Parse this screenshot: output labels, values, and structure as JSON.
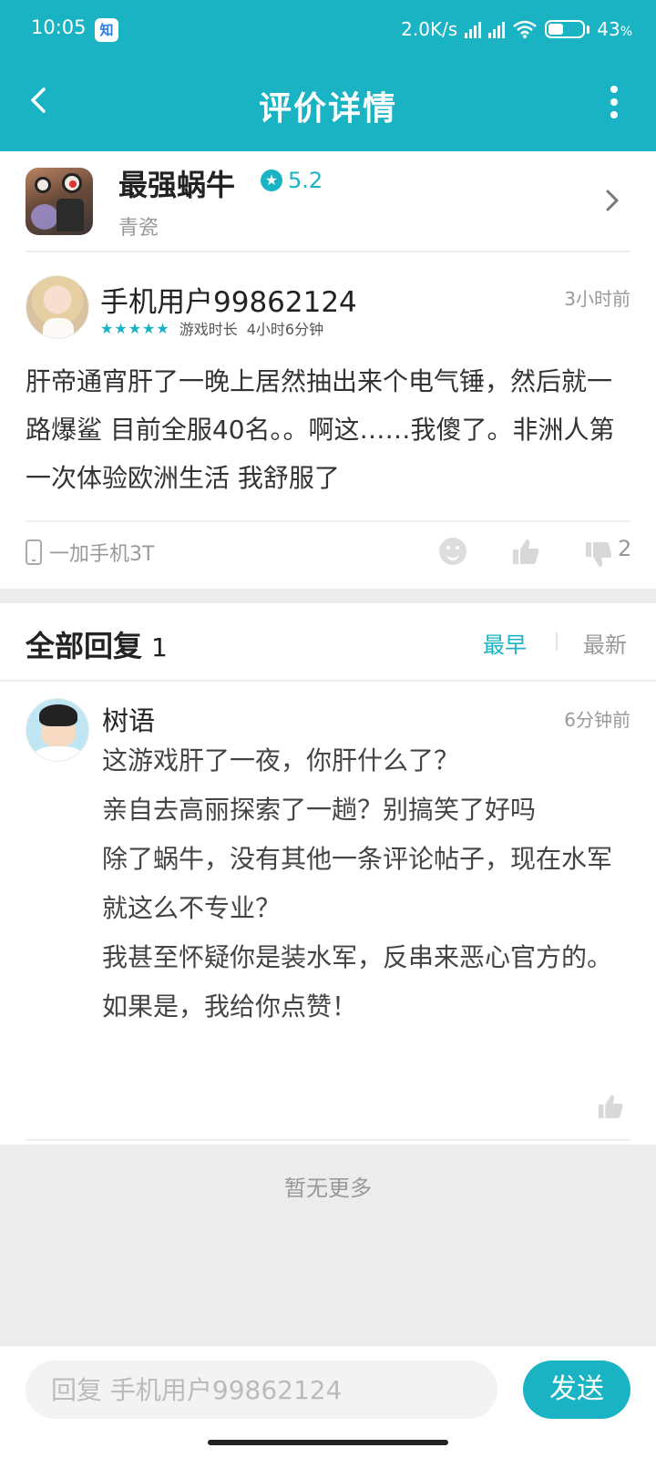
{
  "status_bar": {
    "time": "10:05",
    "app_badge": "知",
    "net_speed": "2.0K/s",
    "battery_pct": "43",
    "battery_pct_unit": "%",
    "battery_level": 0.43
  },
  "header": {
    "title": "评价详情"
  },
  "game": {
    "name": "最强蜗牛",
    "rating": "5.2",
    "developer": "青瓷"
  },
  "review": {
    "username": "手机用户99862124",
    "time_ago": "3小时前",
    "stars": "★★★★★",
    "star_count": 5,
    "playtime_label": "游戏时长",
    "playtime_value": "4小时6分钟",
    "body": "肝帝通宵肝了一晚上居然抽出来个电气锤，然后就一路爆鲨 目前全服40名。。啊这……我傻了。非洲人第一次体验欧洲生活 我舒服了",
    "device": "一加手机3T",
    "dislike_count": "2"
  },
  "replies": {
    "title": "全部回复",
    "count": "1",
    "sort_earliest": "最早",
    "sort_newest": "最新",
    "items": [
      {
        "username": "树语",
        "time_ago": "6分钟前",
        "lines": [
          "这游戏肝了一夜，你肝什么了？",
          "亲自去高丽探索了一趟？别搞笑了好吗",
          "除了蜗牛，没有其他一条评论帖子，现在水军就这么不专业？",
          "我甚至怀疑你是装水军，反串来恶心官方的。",
          "如果是，我给你点赞！"
        ]
      }
    ],
    "no_more": "暂无更多"
  },
  "reply_bar": {
    "placeholder": "回复 手机用户99862124",
    "value": "",
    "send_label": "发送"
  },
  "colors": {
    "accent": "#1ab3c4"
  }
}
